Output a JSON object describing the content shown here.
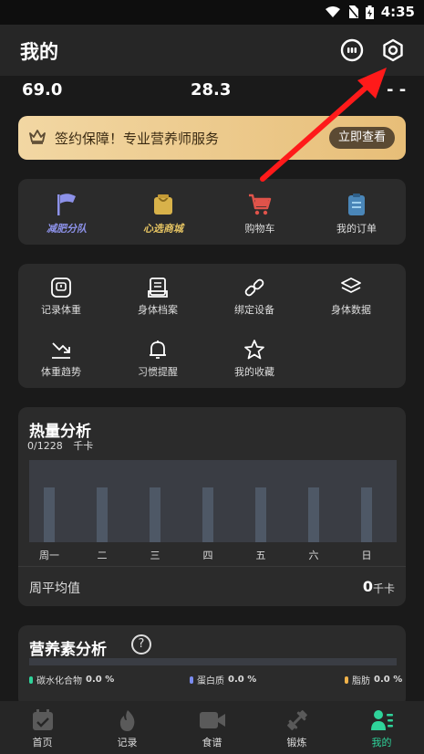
{
  "status": {
    "time": "4:35"
  },
  "header": {
    "title": "我的"
  },
  "stats": {
    "weight": "69.0",
    "bmi": "28.3",
    "extra": "- -"
  },
  "vip": {
    "text": "签约保障！专业营养师服务",
    "button": "立即查看"
  },
  "shortcuts": [
    {
      "label": "减肥分队",
      "icon": "flag-icon"
    },
    {
      "label": "心选商城",
      "icon": "shop-bag-icon"
    },
    {
      "label": "购物车",
      "icon": "cart-icon"
    },
    {
      "label": "我的订单",
      "icon": "order-icon"
    }
  ],
  "tools": [
    {
      "label": "记录体重",
      "icon": "scale-icon"
    },
    {
      "label": "身体档案",
      "icon": "file-icon"
    },
    {
      "label": "绑定设备",
      "icon": "link-icon"
    },
    {
      "label": "身体数据",
      "icon": "layers-icon"
    },
    {
      "label": "体重趋势",
      "icon": "trend-down-icon"
    },
    {
      "label": "习惯提醒",
      "icon": "bell-icon"
    },
    {
      "label": "我的收藏",
      "icon": "star-icon"
    }
  ],
  "calorie": {
    "title": "热量分析",
    "summary": "0/1228",
    "unit": "千卡",
    "avg_label": "周平均值",
    "avg_value": "0",
    "avg_unit": "千卡"
  },
  "chart_data": {
    "type": "bar",
    "categories": [
      "周一",
      "二",
      "三",
      "四",
      "五",
      "六",
      "日"
    ],
    "values": [
      0,
      0,
      0,
      0,
      0,
      0,
      0
    ],
    "title": "热量分析",
    "ylabel": "千卡"
  },
  "nutrition": {
    "title": "营养素分析",
    "help": "?",
    "items": [
      {
        "label": "碳水化合物",
        "value": "0.0 %",
        "color": "#2fd39a"
      },
      {
        "label": "蛋白质",
        "value": "0.0 %",
        "color": "#7b8cf0"
      },
      {
        "label": "脂肪",
        "value": "0.0 %",
        "color": "#f0b24a"
      }
    ]
  },
  "tabs": [
    {
      "label": "首页",
      "icon": "calendar-icon"
    },
    {
      "label": "记录",
      "icon": "flame-icon"
    },
    {
      "label": "食谱",
      "icon": "video-icon"
    },
    {
      "label": "锻炼",
      "icon": "dumbbell-icon"
    },
    {
      "label": "我的",
      "icon": "profile-icon"
    }
  ],
  "colors": {
    "accent": "#2fd39a",
    "arrow": "#ff1a1a",
    "vip_gold": "#f2d7a3"
  }
}
